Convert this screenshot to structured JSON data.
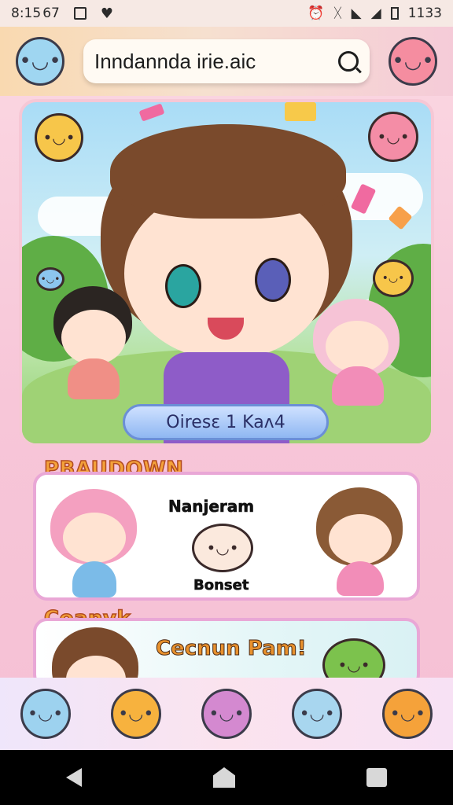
{
  "status_bar": {
    "time": "8:15",
    "signal_text": "67",
    "battery_text": "1133"
  },
  "top_bar": {
    "search_text": "Inndannda irie.aic",
    "left_mascot": "blue-cat-mascot",
    "right_mascot": "pink-blob-mascot",
    "search_icon": "search-icon"
  },
  "hero": {
    "button_label": "Oiresɛ 1 Kaʌ4"
  },
  "section1": {
    "title": "PBAUDOWN",
    "card_label_top": "Nanjeram",
    "card_label_bottom": "Bonset"
  },
  "section2": {
    "title": "Coanvk",
    "card_label": "Cecnun Pam!"
  },
  "bottom_nav": {
    "items": [
      "blue-jellyfish-icon",
      "orange-cat-icon",
      "purple-cat-icon",
      "blue-jellyfish-icon-2",
      "orange-fox-icon"
    ]
  },
  "colors": {
    "accent_pink": "#f6c7d5",
    "title_orange": "#f4a23a",
    "pill_blue": "#8fb7f2"
  }
}
